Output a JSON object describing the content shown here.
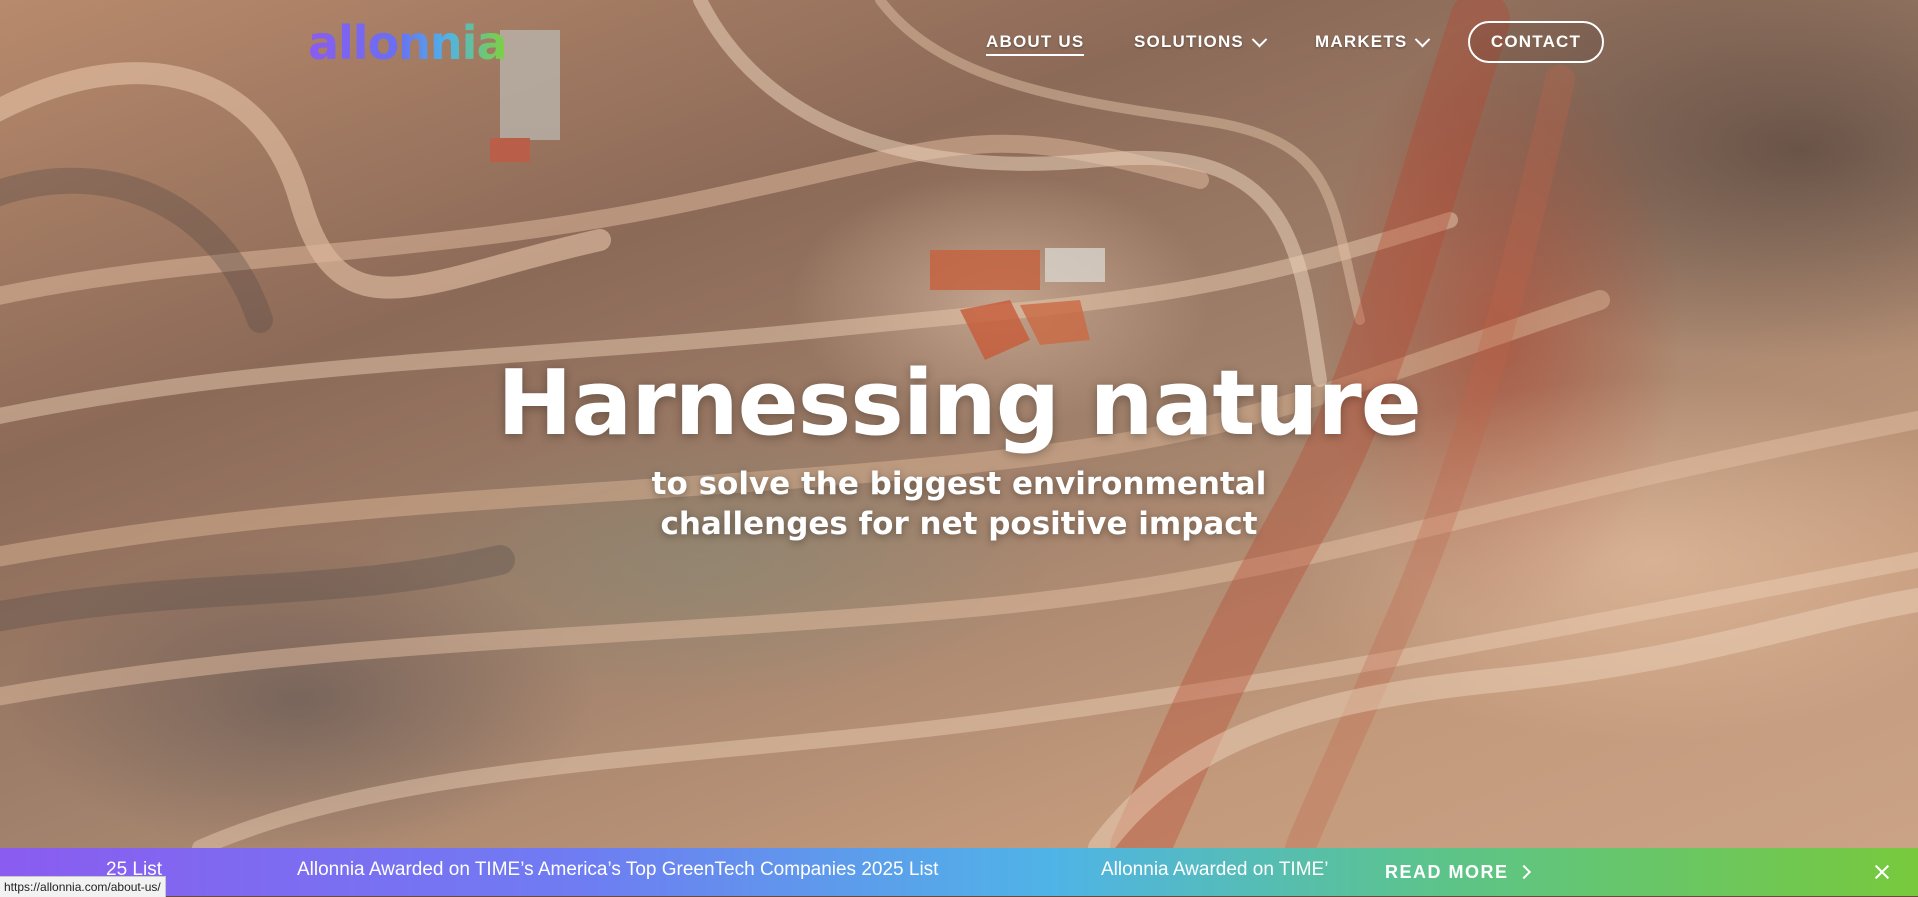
{
  "brand": {
    "logo_text": "allonnia"
  },
  "nav": {
    "items": [
      {
        "label": "ABOUT US",
        "active": true,
        "has_dropdown": false
      },
      {
        "label": "SOLUTIONS",
        "active": false,
        "has_dropdown": true
      },
      {
        "label": "MARKETS",
        "active": false,
        "has_dropdown": true
      }
    ],
    "contact_label": "CONTACT"
  },
  "hero": {
    "headline": "Harnessing nature",
    "subheadline": "to solve the biggest environmental challenges for net positive impact"
  },
  "banner": {
    "ticker_fragment_left": "25 List",
    "ticker_main": "Allonnia Awarded on TIME’s America’s Top GreenTech Companies 2025 List",
    "ticker_fragment_right": "Allonnia Awarded on TIME’",
    "read_more_label": "READ MORE"
  },
  "status_bar": {
    "url": "https://allonnia.com/about-us/"
  },
  "colors": {
    "brand_purple": "#8a5cf0",
    "brand_blue": "#4fb4e6",
    "brand_green": "#78c93c",
    "text_white": "#ffffff"
  }
}
